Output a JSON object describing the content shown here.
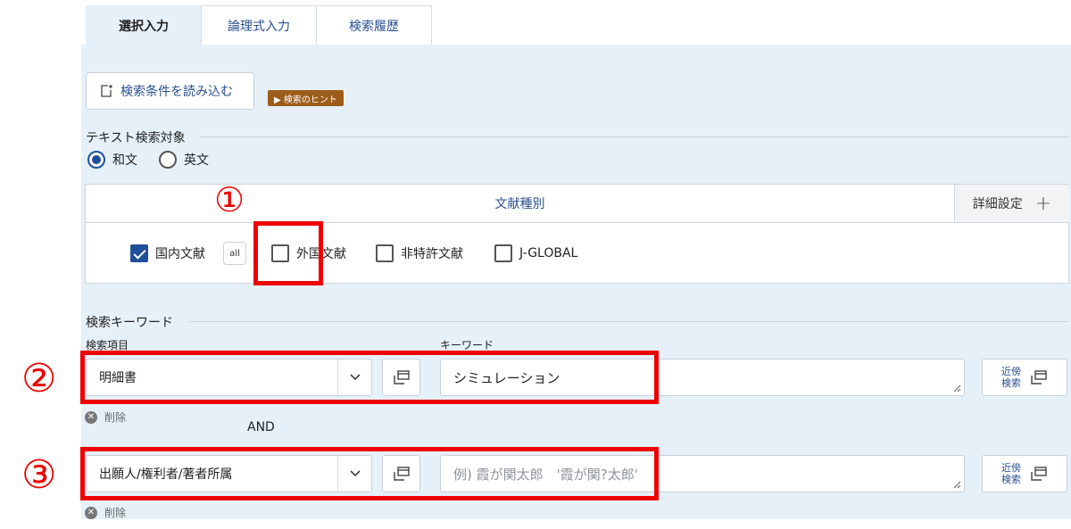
{
  "tabs": [
    {
      "label": "選択入力",
      "active": true
    },
    {
      "label": "論理式入力",
      "active": false
    },
    {
      "label": "検索履歴",
      "active": false
    }
  ],
  "toolbar": {
    "load_label": "検索条件を読み込む",
    "hint_label": "▶ 検索のヒント"
  },
  "text_target": {
    "title": "テキスト検索対象",
    "options": [
      {
        "label": "和文",
        "selected": true
      },
      {
        "label": "英文",
        "selected": false
      }
    ]
  },
  "doc_types": {
    "header": "文献種別",
    "detail_label": "詳細設定",
    "all_label": "all",
    "items": [
      {
        "label": "国内文献",
        "checked": true
      },
      {
        "label": "外国文献",
        "checked": false
      },
      {
        "label": "非特許文献",
        "checked": false
      },
      {
        "label": "J-GLOBAL",
        "checked": false
      }
    ]
  },
  "keywords": {
    "title": "検索キーワード",
    "field_label": "検索項目",
    "keyword_label": "キーワード",
    "near_label_1": "近傍",
    "near_label_2": "検索",
    "delete_label": "削除",
    "operator": "AND",
    "rows": [
      {
        "field": "明細書",
        "keyword": "シミュレーション",
        "placeholder": ""
      },
      {
        "field": "出願人/権利者/著者所属",
        "keyword": "",
        "placeholder": "例) 霞が関太郎　'霞が関?太郎'"
      }
    ]
  },
  "annotations": {
    "n1": "①",
    "n2": "②",
    "n3": "③"
  },
  "colors": {
    "panel_bg": "#e6f0f8",
    "accent_blue": "#1f4f99",
    "link_blue": "#2a4f8f",
    "hint_brown": "#9c5d1a",
    "annotation_red": "#ee0000"
  }
}
